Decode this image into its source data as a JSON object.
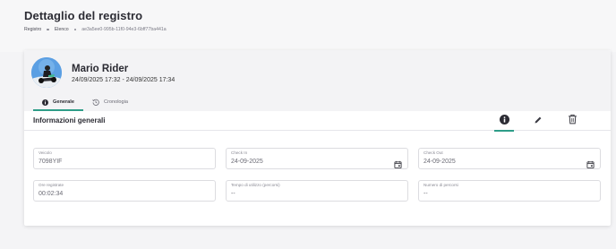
{
  "page": {
    "title": "Dettaglio del registro",
    "breadcrumb": [
      "Registro",
      "Elenco",
      "ae3a5ee0-995b-11f0-94e3-6bff77ba441a"
    ]
  },
  "user": {
    "name": "Mario Rider",
    "dates": "24/09/2025 17:32 - 24/09/2025 17:34"
  },
  "tabs": [
    {
      "label": "Generale",
      "icon": "info-icon",
      "active": true
    },
    {
      "label": "Cronologia",
      "icon": "history-icon",
      "active": false
    }
  ],
  "section": {
    "title": "Informazioni generali",
    "actions": [
      "info-icon",
      "edit-pencil-icon",
      "delete-trash-icon"
    ]
  },
  "fields": {
    "veicolo": {
      "label": "Veicolo",
      "value": "7098YIF"
    },
    "check_in": {
      "label": "Check In",
      "value": "24-09-2025"
    },
    "check_out": {
      "label": "Check Out",
      "value": "24-09-2025"
    },
    "ore_registrate": {
      "label": "Ore registrate",
      "value": "00:02:34"
    },
    "tempo_utilizzo": {
      "label": "Tempo di utilizzo (percorsi)",
      "value": "--"
    },
    "numero_percorsi": {
      "label": "Numero di percorsi",
      "value": "--"
    }
  },
  "colors": {
    "accent": "#2e9d88",
    "text": "#2c2c34",
    "muted": "#8a8a94"
  }
}
